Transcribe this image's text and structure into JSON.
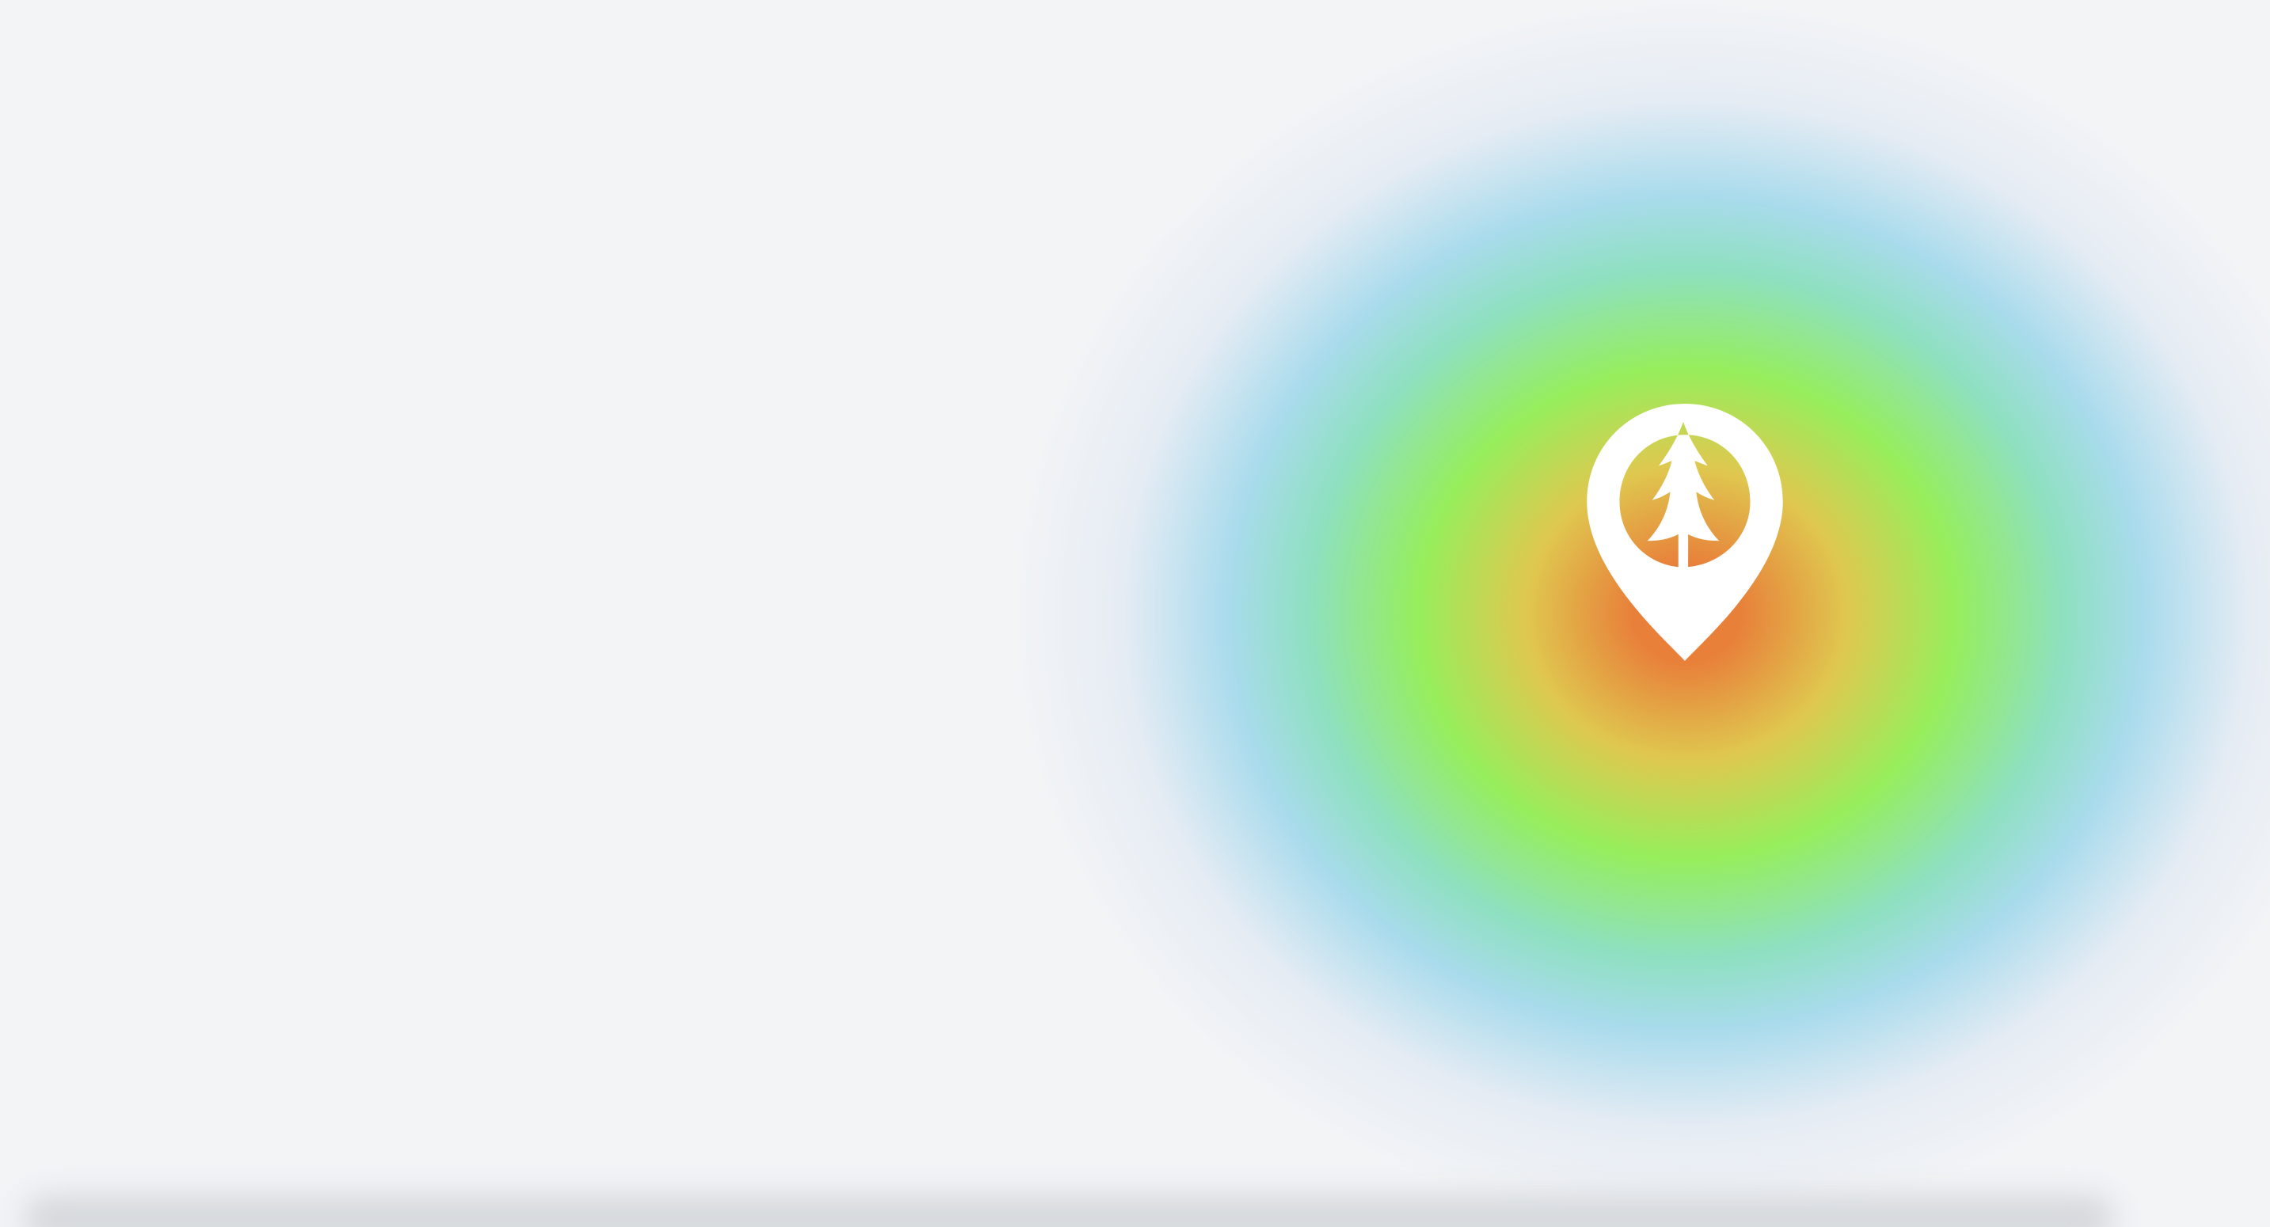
{
  "colors": {
    "background": "#f2f4f6",
    "heat_core": "#e8803a",
    "heat_mid": "#dfc84f",
    "heat_green": "#96ee5c",
    "heat_teal": "#8ee0c0",
    "heat_blue": "#a9dbec",
    "heat_edge": "#e6ecf4",
    "marker_fill": "#ffffff",
    "shadow": "#d5d8dc"
  },
  "map": {
    "marker": {
      "icon": "tree-location-pin-icon"
    },
    "heatmap_layer": "heatmap-glow"
  }
}
